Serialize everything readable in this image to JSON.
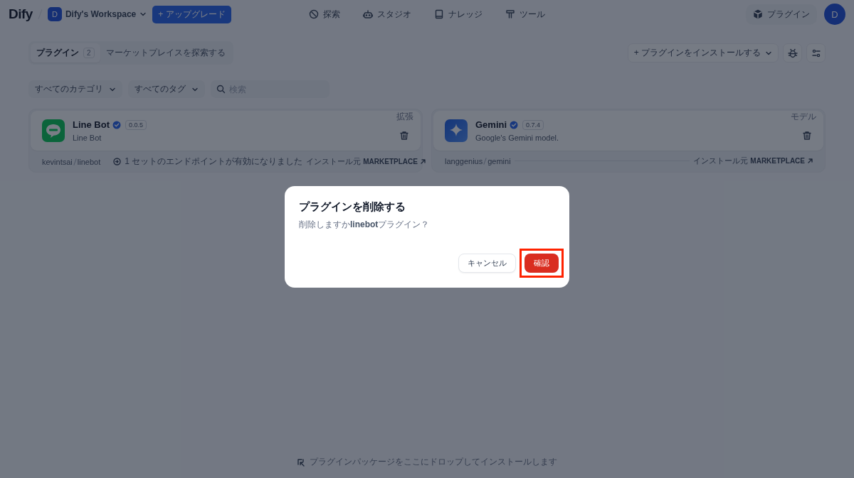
{
  "header": {
    "logo": "Dify",
    "workspace": {
      "avatar": "D",
      "name": "Dify's Workspace"
    },
    "upgrade_button": "+ アップグレード",
    "nav": [
      {
        "kind": "explore",
        "label": "探索",
        "selected": false
      },
      {
        "kind": "studio",
        "label": "スタジオ",
        "selected": false
      },
      {
        "kind": "knowledge",
        "label": "ナレッジ",
        "selected": false
      },
      {
        "kind": "tools",
        "label": "ツール",
        "selected": false
      }
    ],
    "plugins_button": "プラグイン",
    "user_avatar": "D"
  },
  "tabs": [
    {
      "label": "プラグイン",
      "count": "2",
      "selected": true
    },
    {
      "label": "マーケットプレイスを探索する",
      "selected": false
    }
  ],
  "install_button": "+ プラグインをインストールする",
  "filters": {
    "category": "すべてのカテゴリ",
    "tag": "すべてのタグ",
    "search": {
      "placeholder": "検索"
    }
  },
  "plugins": [
    {
      "kind": "line",
      "name": "Line Bot",
      "version": "0.0.5",
      "description": "Line Bot",
      "category": "拡張",
      "author": "kevintsai",
      "slug": "linebot",
      "endpoint_status": "1 セットのエンドポイントが有効になりました",
      "source_label": "インストール元",
      "source": "MARKETPLACE"
    },
    {
      "kind": "gemini",
      "name": "Gemini",
      "version": "0.7.4",
      "description": "Google's Gemini model.",
      "category": "モデル",
      "author": "langgenius",
      "slug": "gemini",
      "source_label": "インストール元",
      "source": "MARKETPLACE"
    }
  ],
  "dialog": {
    "title": "プラグインを削除する",
    "message": "削除しますか**linebot**プラグイン？",
    "cancel_button": "キャンセル",
    "confirm_button": {
      "label": "確認",
      "highlighted": true
    }
  },
  "drop_hint": "プラグインパッケージをここにドロップしてインストールします"
}
